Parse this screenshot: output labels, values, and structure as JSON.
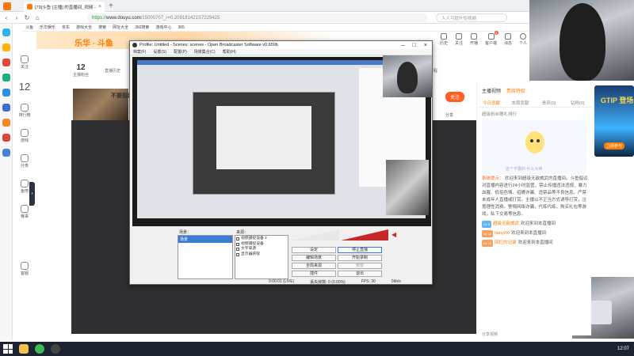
{
  "browser": {
    "tab_title": "[79]斗鱼 [主播] 的直播间_视频 – 斗鱼直播",
    "url_prefix": "https://",
    "url_domain": "www.douyu.com",
    "url_path": "/15000707_r=0.209181421S7229425",
    "search_placeholder": "人人可提升短视频",
    "bookmarks": [
      "斗鱼",
      "乐华娱乐",
      "京东",
      "游戏大全",
      "搜索",
      "网址大全",
      "360搜索",
      "游戏中心",
      "365"
    ]
  },
  "site": {
    "brand": "乐华 · 斗鱼",
    "nav": [
      {
        "label": "关注",
        "icon": "heart-icon"
      },
      {
        "label": "12",
        "icon": "number-badge"
      },
      {
        "label": "排行榜",
        "icon": "rank-icon"
      },
      {
        "label": "游戏",
        "icon": "game-icon"
      },
      {
        "label": "分类",
        "icon": "category-icon"
      },
      {
        "label": "鱼吧",
        "icon": "fish-icon"
      },
      {
        "label": "赛事",
        "icon": "trophy-icon"
      },
      {
        "label": "客服",
        "icon": "support-icon"
      }
    ],
    "header_right": [
      "历史",
      "关注",
      "开播",
      "客户端",
      "消息",
      "个人"
    ],
    "header_badges": {
      "msg": "4"
    },
    "room": {
      "fans_count": "12",
      "fans_label": "主播粉丝",
      "stat2_label": "直播历史",
      "stat2_badge": "1",
      "stat3_label": "主播日程"
    },
    "banner_title": "不要假装",
    "follow_label": "关注",
    "share_label": "分享"
  },
  "obs": {
    "title": "Profile: Untitled - Scenes: scenes - Open Broadcaster Software v0.659b",
    "menus": [
      "档案(F)",
      "设置(S)",
      "配置(P)",
      "场景集合(C)",
      "帮助(H)"
    ],
    "scenes_label": "场景：",
    "scene_selected": "场景",
    "sources_label": "来源：",
    "sources": [
      "视频捕捉设备 2",
      "视频捕捉设备",
      "文字来源",
      "显示器获取"
    ],
    "buttons": {
      "settings": "设定",
      "stop_stream": "停止直播",
      "edit_scene": "编辑场景",
      "start_record": "开始录制",
      "global_sources": "全局来源",
      "preview": "预览",
      "plugins": "插件",
      "exit": "退出"
    },
    "status": {
      "time": "0:00:01 (LIVE)",
      "dropped": "丢失帧数: 0 (0.00%)",
      "fps": "FPS: 30",
      "bitrate": "0kb/s"
    }
  },
  "right_panel": {
    "tab_main": "主播视频",
    "tab_gold": "贵族特权",
    "rank_tabs": [
      "今日贡献",
      "本周贡献",
      "贵宾(0)",
      "钻粉(0)"
    ],
    "desc": "超级粉丝赠礼排行",
    "mascot_msg": "这个不要的 什么大神",
    "system_prefix": "系统提示：",
    "system_text": "欢迎来到超级无敌威武的直播间。斗鱼倡议对直播内容进行24小时监管，禁止传播违法违规、暴力血腥、低俗色情、招嫖诈骗、违禁品等不良信息。严禁未成年人直播或打赏。主播以不正当方式诱导打赏，注意理性消费。警惕网络诈骗，代练代练，购买礼包等游戏，私下交易等信息。",
    "chat": [
      {
        "level": "LV 9",
        "name": "超级无敌威武",
        "text": "欢迎来到本直播间"
      },
      {
        "level": "LV 12",
        "name": "tianyi00",
        "text": "欢迎来到本直播间"
      },
      {
        "level": "LV 10",
        "name": "回忆的记录",
        "text": "欢迎来到本直播间"
      }
    ],
    "share_label": "分享视频"
  },
  "game_banner": {
    "title": "GTIP 登场",
    "go": "立即参与"
  },
  "taskbar": {
    "clock": "12:07"
  }
}
